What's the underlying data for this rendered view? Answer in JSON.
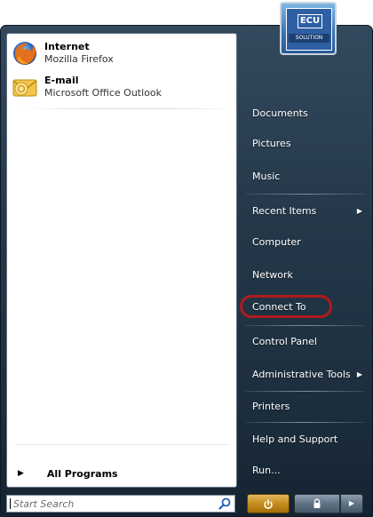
{
  "pinned": [
    {
      "title": "Internet",
      "subtitle": "Mozilla Firefox",
      "icon": "firefox-icon"
    },
    {
      "title": "E-mail",
      "subtitle": "Microsoft Office Outlook",
      "icon": "outlook-icon"
    }
  ],
  "all_programs": {
    "label": "All Programs",
    "icon": "triangle-right-icon"
  },
  "search": {
    "placeholder": "Start Search",
    "icon": "search-icon"
  },
  "user_picture": {
    "brand": "ECU",
    "caption": "SOLUTION"
  },
  "right_menu": [
    {
      "label": "Documents"
    },
    {
      "label": "Pictures"
    },
    {
      "label": "Music"
    },
    {
      "label": "Recent Items",
      "has_submenu": true
    },
    {
      "label": "Computer"
    },
    {
      "label": "Network"
    },
    {
      "label": "Connect To",
      "highlighted": true
    },
    {
      "label": "Control Panel"
    },
    {
      "label": "Administrative Tools",
      "has_submenu": true
    },
    {
      "label": "Printers"
    },
    {
      "label": "Help and Support"
    },
    {
      "label": "Run..."
    }
  ],
  "buttons": {
    "power_icon": "power-icon",
    "lock_icon": "lock-icon",
    "more_icon": "arrow-right-icon"
  },
  "colors": {
    "highlight_ring": "#b01a1a",
    "power_button": "#c58d1d"
  }
}
